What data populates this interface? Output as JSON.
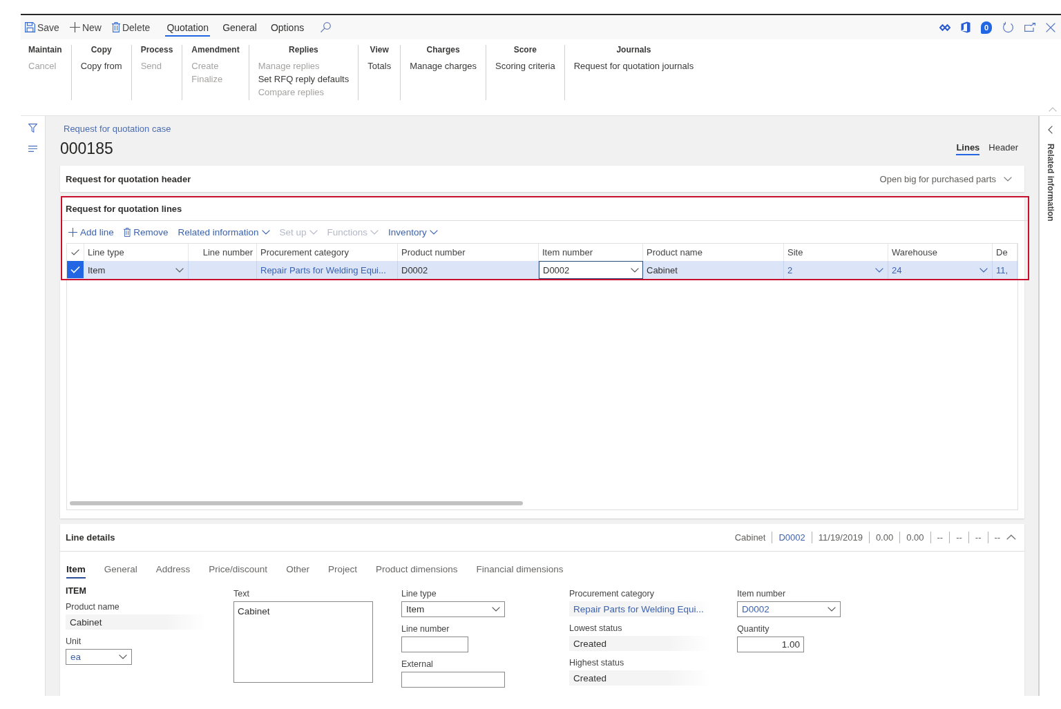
{
  "action_pane": {
    "commands": [
      {
        "label": "Save"
      },
      {
        "label": "New"
      },
      {
        "label": "Delete"
      }
    ],
    "tabs": [
      {
        "label": "Quotation",
        "selected": true
      },
      {
        "label": "General",
        "selected": false
      },
      {
        "label": "Options",
        "selected": false
      }
    ],
    "notification_count": "0"
  },
  "ribbon": {
    "groups": [
      {
        "title": "Maintain",
        "items": [
          {
            "label": "Cancel",
            "disabled": true
          }
        ]
      },
      {
        "title": "Copy",
        "items": [
          {
            "label": "Copy from",
            "disabled": false
          }
        ]
      },
      {
        "title": "Process",
        "items": [
          {
            "label": "Send",
            "disabled": true
          }
        ]
      },
      {
        "title": "Amendment",
        "items": [
          {
            "label": "Create",
            "disabled": true
          },
          {
            "label": "Finalize",
            "disabled": true
          }
        ]
      },
      {
        "title": "Replies",
        "items": [
          {
            "label": "Manage replies",
            "disabled": true
          },
          {
            "label": "Set RFQ reply defaults",
            "disabled": false
          },
          {
            "label": "Compare replies",
            "disabled": true
          }
        ]
      },
      {
        "title": "View",
        "items": [
          {
            "label": "Totals",
            "disabled": false
          }
        ]
      },
      {
        "title": "Charges",
        "items": [
          {
            "label": "Manage charges",
            "disabled": false
          }
        ]
      },
      {
        "title": "Score",
        "items": [
          {
            "label": "Scoring criteria",
            "disabled": false
          }
        ]
      },
      {
        "title": "Journals",
        "items": [
          {
            "label": "Request for quotation journals",
            "disabled": false
          }
        ]
      }
    ]
  },
  "page": {
    "breadcrumb": "Request for quotation case",
    "title": "000185",
    "view_tabs": [
      {
        "label": "Lines",
        "selected": true
      },
      {
        "label": "Header",
        "selected": false
      }
    ]
  },
  "header_section": {
    "title": "Request for quotation header",
    "summary": "Open big for purchased parts",
    "expanded": false
  },
  "lines_section": {
    "title": "Request for quotation lines",
    "highlighted": true,
    "toolbar": [
      {
        "label": "Add line",
        "disabled": false,
        "menu": false
      },
      {
        "label": "Remove",
        "disabled": false,
        "menu": false
      },
      {
        "label": "Related information",
        "disabled": false,
        "menu": true
      },
      {
        "label": "Set up",
        "disabled": true,
        "menu": true
      },
      {
        "label": "Functions",
        "disabled": true,
        "menu": true
      },
      {
        "label": "Inventory",
        "disabled": false,
        "menu": true
      }
    ],
    "grid": {
      "columns": [
        {
          "label": "Line type",
          "kind": "select"
        },
        {
          "label": "Line number",
          "kind": "number"
        },
        {
          "label": "Procurement category",
          "kind": "link"
        },
        {
          "label": "Product number",
          "kind": "text"
        },
        {
          "label": "Item number",
          "kind": "select"
        },
        {
          "label": "Product name",
          "kind": "text"
        },
        {
          "label": "Site",
          "kind": "link_select"
        },
        {
          "label": "Warehouse",
          "kind": "link_select"
        },
        {
          "label": "De",
          "kind": "link"
        }
      ],
      "rows": [
        {
          "selected": true,
          "cells": [
            {
              "value": "Item",
              "focused": false
            },
            {
              "focused": false
            },
            {
              "value": "Repair Parts for Welding Equi...",
              "focused": false
            },
            {
              "value": "D0002",
              "focused": false
            },
            {
              "value": "D0002",
              "focused": true
            },
            {
              "value": "Cabinet",
              "focused": false
            },
            {
              "value": "2",
              "focused": false
            },
            {
              "value": "24",
              "focused": false
            },
            {
              "value": "11,",
              "focused": false
            }
          ]
        }
      ]
    }
  },
  "line_details": {
    "title": "Line details",
    "expanded": true,
    "summary": [
      {
        "text": "Cabinet",
        "link": false
      },
      {
        "text": "D0002",
        "link": true
      },
      {
        "text": "11/19/2019",
        "link": false
      },
      {
        "text": "0.00",
        "link": false
      },
      {
        "text": "0.00",
        "link": false
      },
      {
        "text": "--",
        "link": false
      },
      {
        "text": "--",
        "link": false
      },
      {
        "text": "--",
        "link": false
      },
      {
        "text": "--",
        "link": false
      }
    ],
    "tabs": [
      {
        "label": "Item",
        "selected": true
      },
      {
        "label": "General",
        "selected": false
      },
      {
        "label": "Address",
        "selected": false
      },
      {
        "label": "Price/discount",
        "selected": false
      },
      {
        "label": "Other",
        "selected": false
      },
      {
        "label": "Project",
        "selected": false
      },
      {
        "label": "Product dimensions",
        "selected": false
      },
      {
        "label": "Financial dimensions",
        "selected": false
      }
    ],
    "field_columns": [
      [
        {
          "kind": "heading",
          "label": "ITEM"
        },
        {
          "kind": "readonly",
          "label": "Product name",
          "value": "Cabinet",
          "linked": false
        },
        {
          "kind": "select",
          "label": "Unit",
          "value": "ea",
          "linked": true
        }
      ],
      [
        {
          "kind": "textarea",
          "label": "Text",
          "value": "Cabinet"
        }
      ],
      [
        {
          "kind": "select",
          "label": "Line type",
          "value": "Item",
          "linked": false
        },
        {
          "kind": "input",
          "label": "Line number"
        },
        {
          "kind": "input",
          "label": "External"
        }
      ],
      [
        {
          "kind": "readonly",
          "label": "Procurement category",
          "value": "Repair Parts for Welding Equi...",
          "linked": true
        },
        {
          "kind": "readonly",
          "label": "Lowest status",
          "value": "Created",
          "linked": false
        },
        {
          "kind": "readonly",
          "label": "Highest status",
          "value": "Created",
          "linked": false
        }
      ],
      [
        {
          "kind": "select",
          "label": "Item number",
          "value": "D0002",
          "linked": true
        },
        {
          "kind": "number",
          "label": "Quantity",
          "value": "1.00"
        }
      ]
    ]
  },
  "related_pane": {
    "title": "Related information"
  }
}
